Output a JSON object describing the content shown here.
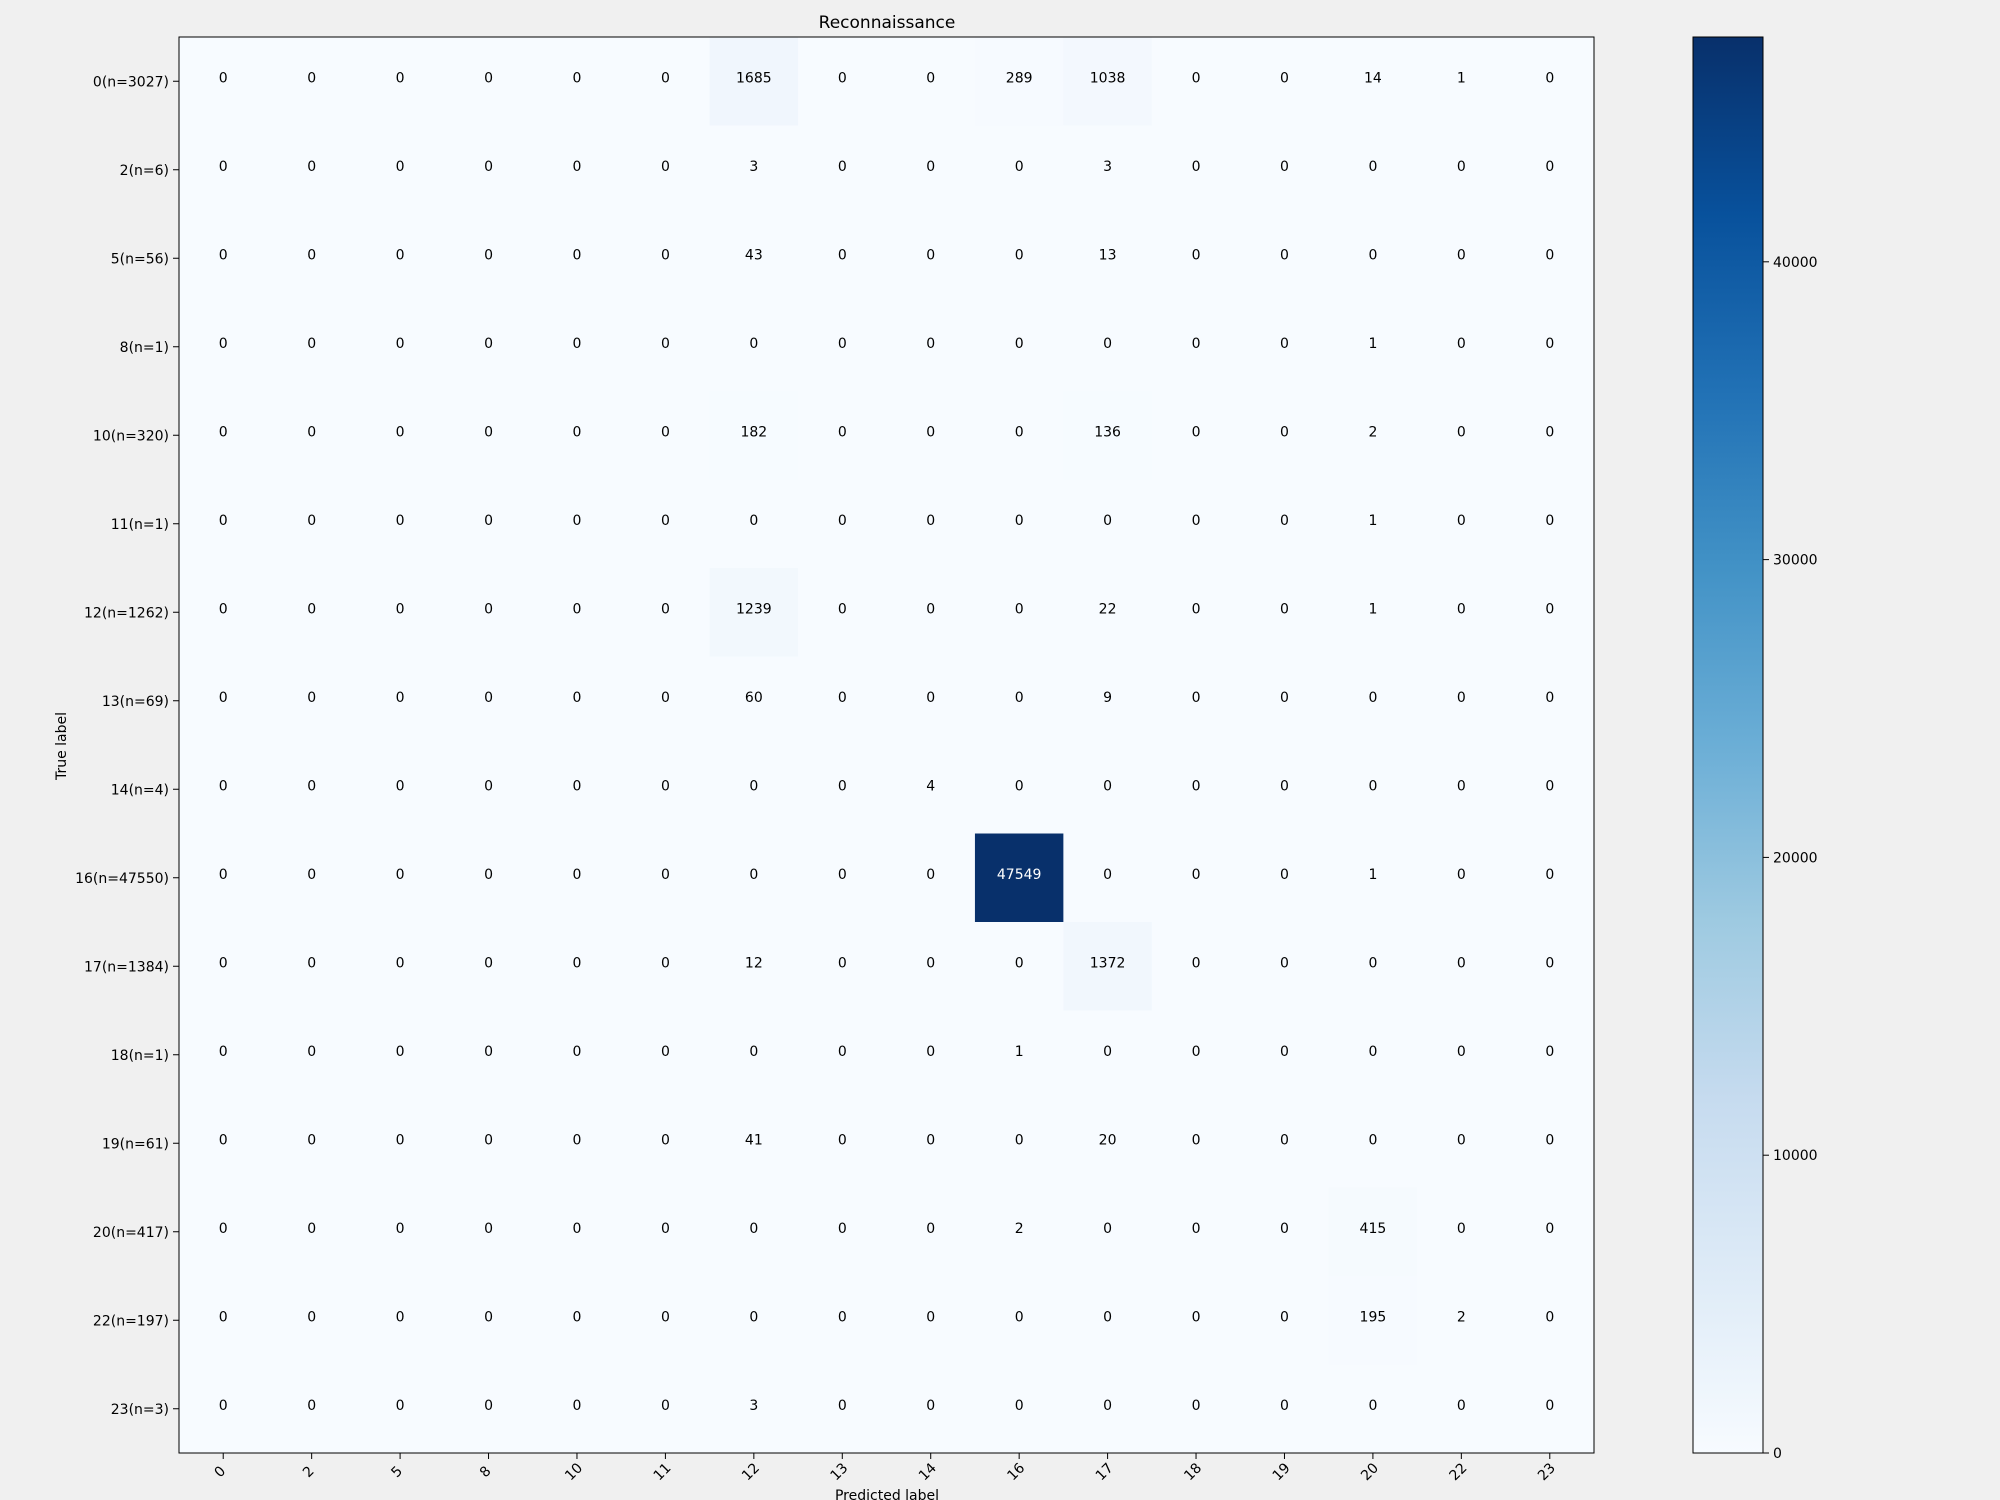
{
  "chart_data": {
    "type": "heatmap",
    "title": "Reconnaissance",
    "xlabel": "Predicted label",
    "ylabel": "True label",
    "x_categories": [
      "0",
      "2",
      "5",
      "8",
      "10",
      "11",
      "12",
      "13",
      "14",
      "16",
      "17",
      "18",
      "19",
      "20",
      "22",
      "23"
    ],
    "y_categories": [
      "0(n=3027)",
      "2(n=6)",
      "5(n=56)",
      "8(n=1)",
      "10(n=320)",
      "11(n=1)",
      "12(n=1262)",
      "13(n=69)",
      "14(n=4)",
      "16(n=47550)",
      "17(n=1384)",
      "18(n=1)",
      "19(n=61)",
      "20(n=417)",
      "22(n=197)",
      "23(n=3)"
    ],
    "values": [
      [
        0,
        0,
        0,
        0,
        0,
        0,
        1685,
        0,
        0,
        289,
        1038,
        0,
        0,
        14,
        1,
        0
      ],
      [
        0,
        0,
        0,
        0,
        0,
        0,
        3,
        0,
        0,
        0,
        3,
        0,
        0,
        0,
        0,
        0
      ],
      [
        0,
        0,
        0,
        0,
        0,
        0,
        43,
        0,
        0,
        0,
        13,
        0,
        0,
        0,
        0,
        0
      ],
      [
        0,
        0,
        0,
        0,
        0,
        0,
        0,
        0,
        0,
        0,
        0,
        0,
        0,
        1,
        0,
        0
      ],
      [
        0,
        0,
        0,
        0,
        0,
        0,
        182,
        0,
        0,
        0,
        136,
        0,
        0,
        2,
        0,
        0
      ],
      [
        0,
        0,
        0,
        0,
        0,
        0,
        0,
        0,
        0,
        0,
        0,
        0,
        0,
        1,
        0,
        0
      ],
      [
        0,
        0,
        0,
        0,
        0,
        0,
        1239,
        0,
        0,
        0,
        22,
        0,
        0,
        1,
        0,
        0
      ],
      [
        0,
        0,
        0,
        0,
        0,
        0,
        60,
        0,
        0,
        0,
        9,
        0,
        0,
        0,
        0,
        0
      ],
      [
        0,
        0,
        0,
        0,
        0,
        0,
        0,
        0,
        4,
        0,
        0,
        0,
        0,
        0,
        0,
        0
      ],
      [
        0,
        0,
        0,
        0,
        0,
        0,
        0,
        0,
        0,
        47549,
        0,
        0,
        0,
        1,
        0,
        0
      ],
      [
        0,
        0,
        0,
        0,
        0,
        0,
        12,
        0,
        0,
        0,
        1372,
        0,
        0,
        0,
        0,
        0
      ],
      [
        0,
        0,
        0,
        0,
        0,
        0,
        0,
        0,
        0,
        1,
        0,
        0,
        0,
        0,
        0,
        0
      ],
      [
        0,
        0,
        0,
        0,
        0,
        0,
        41,
        0,
        0,
        0,
        20,
        0,
        0,
        0,
        0,
        0
      ],
      [
        0,
        0,
        0,
        0,
        0,
        0,
        0,
        0,
        0,
        2,
        0,
        0,
        0,
        415,
        0,
        0
      ],
      [
        0,
        0,
        0,
        0,
        0,
        0,
        0,
        0,
        0,
        0,
        0,
        0,
        0,
        195,
        2,
        0
      ],
      [
        0,
        0,
        0,
        0,
        0,
        0,
        3,
        0,
        0,
        0,
        0,
        0,
        0,
        0,
        0,
        0
      ]
    ],
    "colormap": "Blues",
    "colorbar": {
      "vmin": 0,
      "vmax": 47549,
      "ticks": [
        0,
        10000,
        20000,
        30000,
        40000
      ],
      "tick_labels": [
        "0",
        "10000",
        "20000",
        "30000",
        "40000"
      ]
    },
    "grid": false,
    "legend": "none"
  }
}
